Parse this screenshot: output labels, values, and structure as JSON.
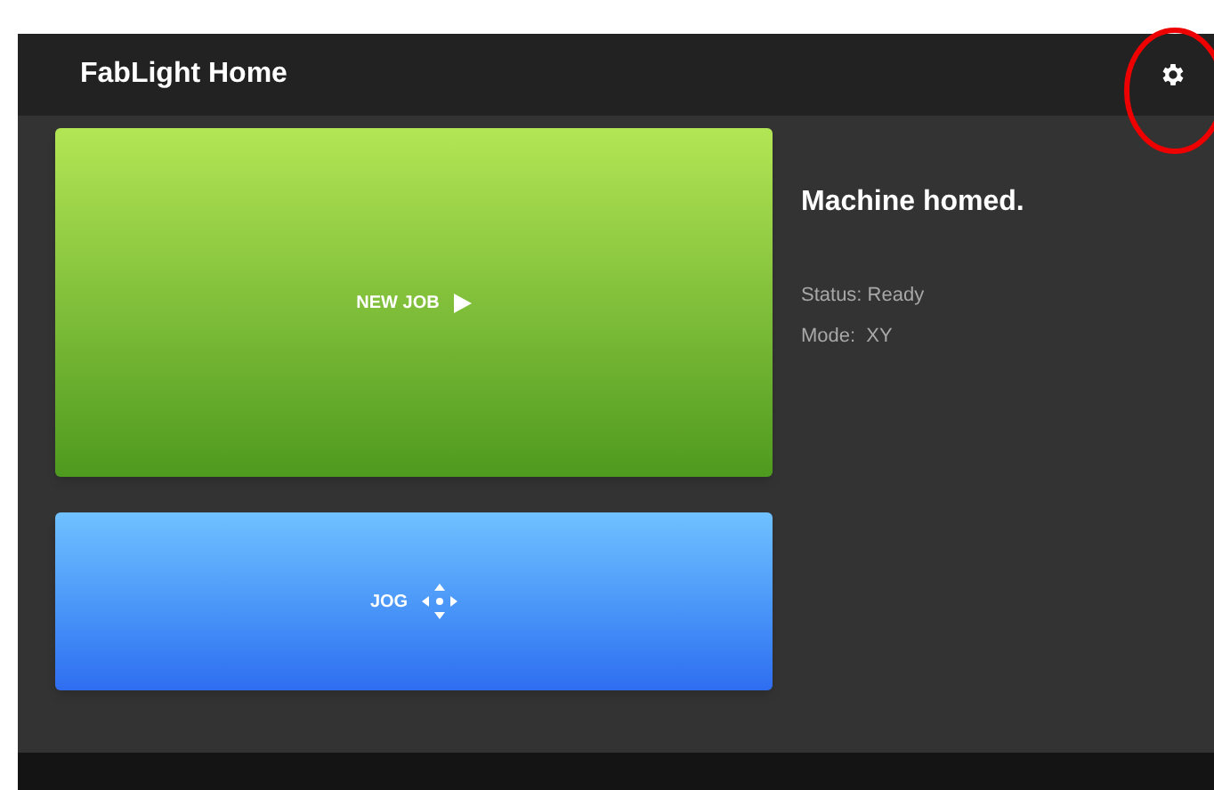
{
  "app_bar": {
    "title": "FabLight Home"
  },
  "actions": [
    {
      "label": "NEW JOB",
      "kind": "play"
    },
    {
      "label": "JOG",
      "kind": "move"
    }
  ],
  "status_panel": {
    "heading": "Machine homed.",
    "lines": [
      "Status: Ready",
      "Mode:  XY"
    ]
  }
}
